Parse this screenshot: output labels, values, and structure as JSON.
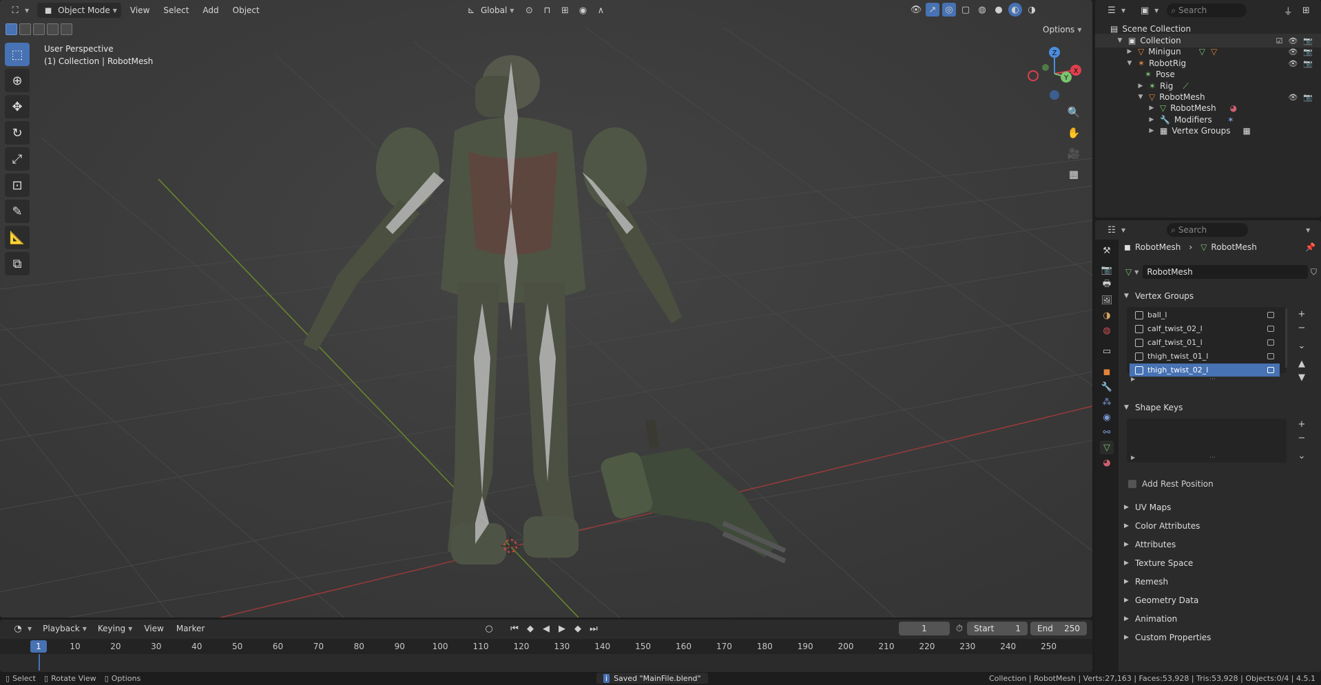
{
  "viewport": {
    "header": {
      "mode": "Object Mode",
      "menus": [
        "View",
        "Select",
        "Add",
        "Object"
      ],
      "transform_orientation": "Global",
      "options_label": "Options"
    },
    "overlay": {
      "perspective": "User Perspective",
      "collection_line": "(1) Collection | RobotMesh"
    },
    "gizmo": {
      "z": "Z",
      "y": "Y",
      "x": "X",
      "colors": {
        "x": "#e0404e",
        "y": "#7ac36f",
        "z": "#4b8de0"
      }
    },
    "tools": [
      "select-box-icon",
      "cursor-icon",
      "move-icon",
      "rotate-icon",
      "scale-icon",
      "transform-icon",
      "annotate-icon",
      "measure-icon",
      "add-cube-icon"
    ]
  },
  "timeline": {
    "menus": [
      "Playback",
      "Keying",
      "View",
      "Marker"
    ],
    "current_frame": "1",
    "start_label": "Start",
    "start_value": "1",
    "end_label": "End",
    "end_value": "250",
    "ruler": [
      "10",
      "20",
      "30",
      "40",
      "50",
      "60",
      "70",
      "80",
      "90",
      "100",
      "110",
      "120",
      "130",
      "140",
      "150",
      "160",
      "170",
      "180",
      "190",
      "200",
      "210",
      "220",
      "230",
      "240",
      "250"
    ],
    "ruler_current": "1"
  },
  "statusbar": {
    "select": "Select",
    "rotate": "Rotate View",
    "options": "Options",
    "message": "Saved \"MainFile.blend\"",
    "stats": "Collection | RobotMesh | Verts:27,163 | Faces:53,928 | Tris:53,928 | Objects:0/4 | 4.5.1"
  },
  "outliner": {
    "search_placeholder": "Search",
    "scene_collection": "Scene Collection",
    "items": [
      {
        "label": "Collection"
      },
      {
        "label": "Minigun"
      },
      {
        "label": "RobotRig"
      },
      {
        "label": "Pose"
      },
      {
        "label": "Rig"
      },
      {
        "label": "RobotMesh"
      },
      {
        "label": "RobotMesh"
      },
      {
        "label": "Modifiers"
      },
      {
        "label": "Vertex Groups"
      }
    ]
  },
  "properties": {
    "search_placeholder": "Search",
    "breadcrumb": [
      "RobotMesh",
      "RobotMesh"
    ],
    "data_name": "RobotMesh",
    "vertex_groups_title": "Vertex Groups",
    "vertex_groups": [
      "ball_l",
      "calf_twist_02_l",
      "calf_twist_01_l",
      "thigh_twist_01_l",
      "thigh_twist_02_l"
    ],
    "selected_group": "thigh_twist_02_l",
    "shape_keys_title": "Shape Keys",
    "add_rest_position": "Add Rest Position",
    "panels": [
      "UV Maps",
      "Color Attributes",
      "Attributes",
      "Texture Space",
      "Remesh",
      "Geometry Data",
      "Animation",
      "Custom Properties"
    ]
  }
}
